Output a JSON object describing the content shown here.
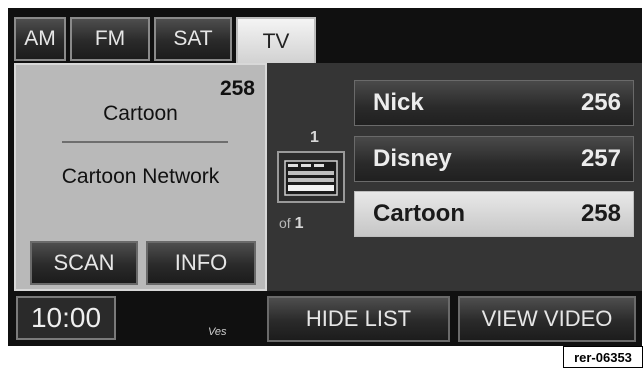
{
  "tabs": [
    {
      "label": "AM",
      "active": false
    },
    {
      "label": "FM",
      "active": false
    },
    {
      "label": "SAT",
      "active": false
    },
    {
      "label": "TV",
      "active": true
    }
  ],
  "now_playing": {
    "preset_number": "258",
    "short_name": "Cartoon",
    "long_name": "Cartoon Network",
    "scan_label": "SCAN",
    "info_label": "INFO"
  },
  "page_indicator": {
    "current": "1",
    "of_label": "of",
    "total": "1"
  },
  "channels": [
    {
      "name": "Nick",
      "number": "256",
      "selected": false
    },
    {
      "name": "Disney",
      "number": "257",
      "selected": false
    },
    {
      "name": "Cartoon",
      "number": "258",
      "selected": true
    }
  ],
  "bottom_bar": {
    "clock": "10:00",
    "small_text": "Ves",
    "hide_list_label": "HIDE LIST",
    "view_video_label": "VIEW VIDEO"
  },
  "reference_code": "rer-06353",
  "colors": {
    "panel_light": "#b9b9b9",
    "background": "#101010",
    "selected_row": "#d0d0d0"
  }
}
